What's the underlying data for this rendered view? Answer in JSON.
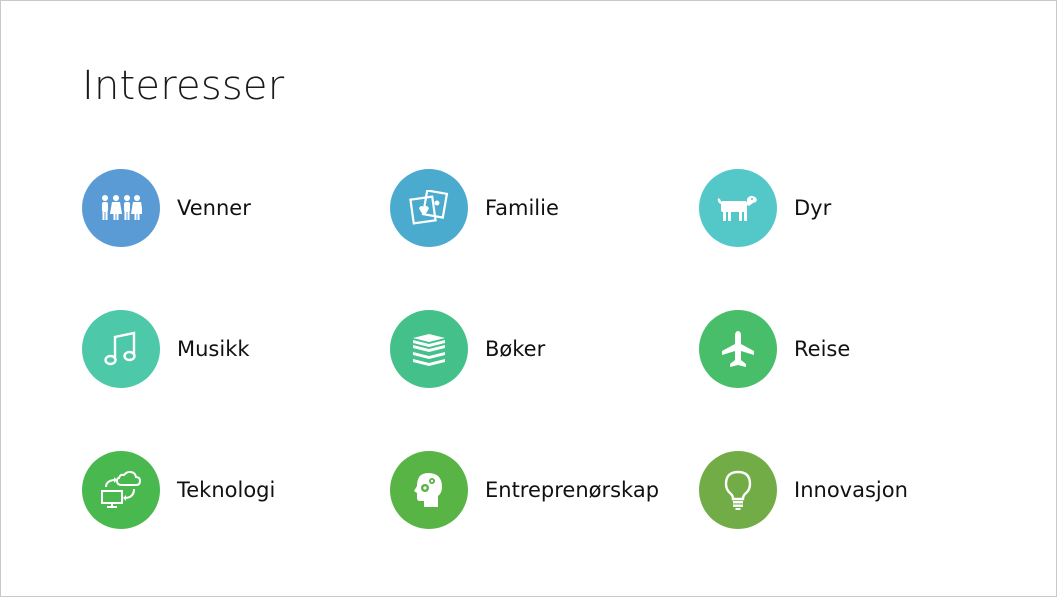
{
  "slide": {
    "title": "Interesser",
    "items": [
      {
        "label": "Venner",
        "icon": "people-icon",
        "color": "#5B9BD5"
      },
      {
        "label": "Familie",
        "icon": "photos-icon",
        "color": "#4AABCF"
      },
      {
        "label": "Dyr",
        "icon": "dog-icon",
        "color": "#54C8C8"
      },
      {
        "label": "Musikk",
        "icon": "music-note-icon",
        "color": "#4DC8A8"
      },
      {
        "label": "Bøker",
        "icon": "books-icon",
        "color": "#44C08A"
      },
      {
        "label": "Reise",
        "icon": "airplane-icon",
        "color": "#48BD6A"
      },
      {
        "label": "Teknologi",
        "icon": "cloud-computer-icon",
        "color": "#49B84F"
      },
      {
        "label": "Entreprenørskap",
        "icon": "head-gears-icon",
        "color": "#58B444"
      },
      {
        "label": "Innovasjon",
        "icon": "lightbulb-icon",
        "color": "#72AC47"
      }
    ]
  }
}
